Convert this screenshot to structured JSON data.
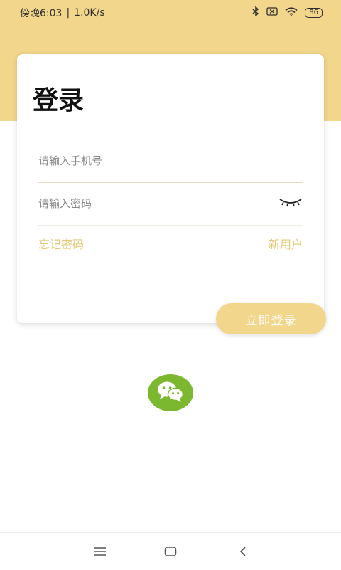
{
  "status_bar": {
    "time": "傍晚6:03",
    "separator": "|",
    "speed": "1.0K/s",
    "battery": "86"
  },
  "login": {
    "title": "登录",
    "phone_placeholder": "请输入手机号",
    "password_placeholder": "请输入密码",
    "forgot_password": "忘记密码",
    "new_user": "新用户",
    "submit": "立即登录"
  },
  "icons": {
    "password_toggle": "eye-closed-icon",
    "third_party_login": "wechat-icon",
    "nav_menu": "menu-icon",
    "nav_home": "home-icon",
    "nav_back": "back-icon"
  },
  "colors": {
    "accent": "#f2d68b",
    "link": "#e6c978",
    "wechat": "#7cb82f"
  }
}
